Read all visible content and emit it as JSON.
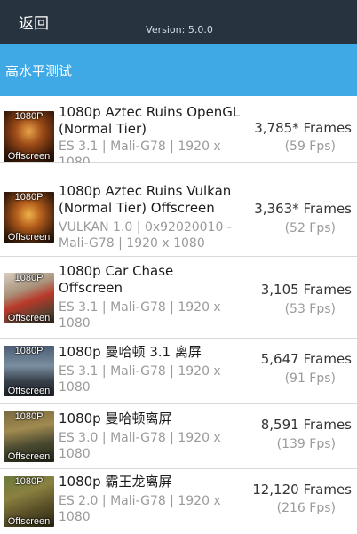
{
  "header": {
    "back_label": "返回",
    "version": "Version: 5.0.0"
  },
  "section": {
    "title": "高水平测试"
  },
  "tests": [
    {
      "thumb_res": "1080P",
      "thumb_off": "Offscreen",
      "title": "1080p Aztec Ruins OpenGL (Normal Tier)",
      "details": "ES 3.1 | Mali-G78 | 1920 x 1080",
      "frames": "3,785* Frames",
      "fps": "(59 Fps)"
    },
    {
      "thumb_res": "1080P",
      "thumb_off": "Offscreen",
      "title": "1080p Aztec Ruins Vulkan (Normal Tier) Offscreen",
      "details": "VULKAN 1.0 | 0x92020010 - Mali-G78 | 1920 x 1080",
      "frames": "3,363* Frames",
      "fps": "(52 Fps)"
    },
    {
      "thumb_res": "1080P",
      "thumb_off": "Offscreen",
      "title": "1080p Car Chase Offscreen",
      "details": "ES 3.1 | Mali-G78 | 1920 x 1080",
      "frames": "3,105 Frames",
      "fps": "(53 Fps)"
    },
    {
      "thumb_res": "1080P",
      "thumb_off": "Offscreen",
      "title": "1080p 曼哈顿 3.1 离屏",
      "details": "ES 3.1 | Mali-G78 | 1920 x 1080",
      "frames": "5,647 Frames",
      "fps": "(91 Fps)"
    },
    {
      "thumb_res": "1080P",
      "thumb_off": "Offscreen",
      "title": "1080p 曼哈顿离屏",
      "details": "ES 3.0 | Mali-G78 | 1920 x 1080",
      "frames": "8,591 Frames",
      "fps": "(139 Fps)"
    },
    {
      "thumb_res": "1080P",
      "thumb_off": "Offscreen",
      "title": "1080p 霸王龙离屏",
      "details": "ES 2.0 | Mali-G78 | 1920 x 1080",
      "frames": "12,120 Frames",
      "fps": "(216 Fps)"
    }
  ]
}
